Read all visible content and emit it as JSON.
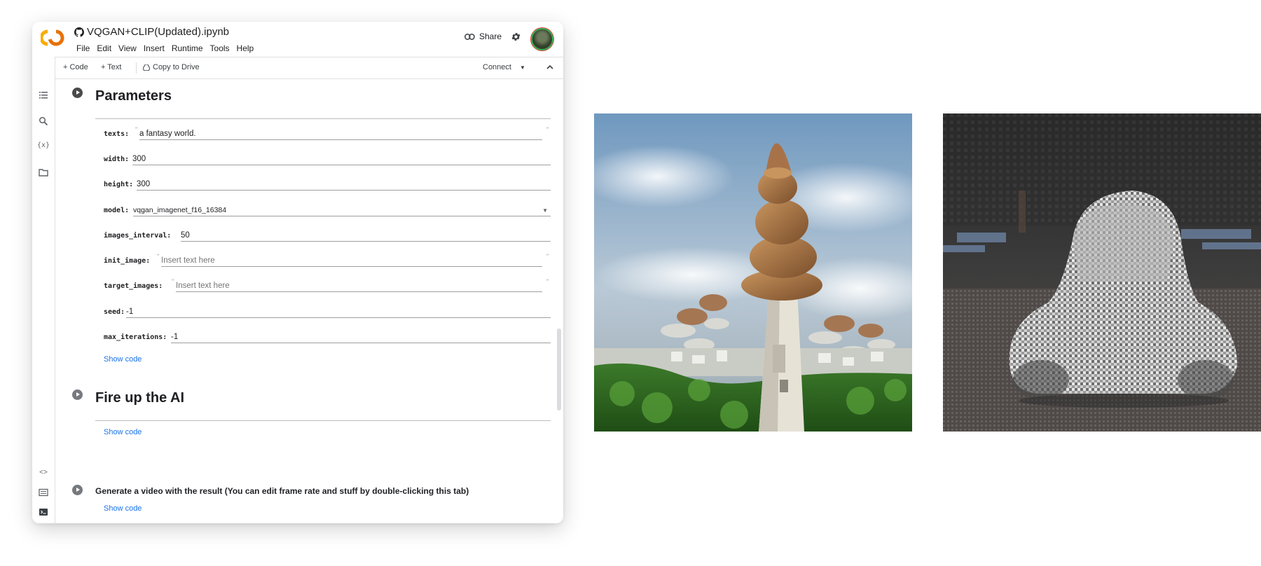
{
  "notebook": {
    "title": "VQGAN+CLIP(Updated).ipynb",
    "menu": [
      "File",
      "Edit",
      "View",
      "Insert",
      "Runtime",
      "Tools",
      "Help"
    ],
    "share_label": "Share",
    "toolbar": {
      "code_label": "+ Code",
      "text_label": "+ Text",
      "copy_label": "Copy to Drive",
      "connect_label": "Connect"
    }
  },
  "sidebar": {
    "icons": [
      "toc-icon",
      "search-icon",
      "variables-icon",
      "folder-icon",
      "code-snippets-icon",
      "command-palette-icon",
      "terminal-icon"
    ]
  },
  "parameters": {
    "heading": "Parameters",
    "fields": [
      {
        "label": "texts:",
        "value": "a fantasy world.",
        "placeholder": false
      },
      {
        "label": "width:",
        "value": "300",
        "placeholder": false
      },
      {
        "label": "height:",
        "value": "300",
        "placeholder": false
      },
      {
        "label": "model:",
        "value": "vqgan_imagenet_f16_16384",
        "placeholder": false
      },
      {
        "label": "images_interval:",
        "value": "50",
        "placeholder": false
      },
      {
        "label": "init_image:",
        "value": "Insert text here",
        "placeholder": true
      },
      {
        "label": "target_images:",
        "value": "Insert text here",
        "placeholder": true
      },
      {
        "label": "seed:",
        "value": "-1",
        "placeholder": false
      },
      {
        "label": "max_iterations:",
        "value": "-1",
        "placeholder": false
      }
    ],
    "show_code": "Show code"
  },
  "fire_up": {
    "heading": "Fire up the AI",
    "show_code": "Show code"
  },
  "video": {
    "heading": "Generate a video with the result (You can edit frame rate and stuff by double-clicking this tab)",
    "show_code": "Show code"
  },
  "colors": {
    "link": "#1a73e8",
    "logo_orange": "#f9ab00",
    "logo_dark_orange": "#e8710a"
  }
}
